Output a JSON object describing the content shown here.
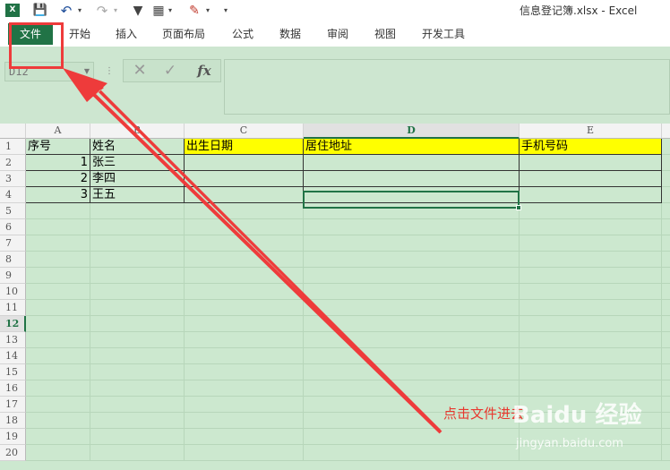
{
  "window": {
    "title": "信息登记簿.xlsx - Excel",
    "app_logo": "X"
  },
  "quick_access": {
    "icons": [
      "excel-logo-icon",
      "save-icon",
      "undo-icon",
      "redo-icon",
      "filter-icon",
      "form-icon",
      "clear-format-icon",
      "customize-icon"
    ]
  },
  "ribbon": {
    "tabs": [
      "文件",
      "开始",
      "插入",
      "页面布局",
      "公式",
      "数据",
      "审阅",
      "视图",
      "开发工具"
    ]
  },
  "formula_bar": {
    "name_box": "D12",
    "fx_label": "fx",
    "formula": ""
  },
  "sheet": {
    "columns": [
      "A",
      "B",
      "C",
      "D",
      "E"
    ],
    "selected_column": "D",
    "selected_row": "12",
    "rows": [
      "1",
      "2",
      "3",
      "4",
      "5",
      "6",
      "7",
      "8",
      "9",
      "10",
      "11",
      "12",
      "13",
      "14",
      "15",
      "16",
      "17",
      "18",
      "19",
      "20"
    ],
    "header_row": [
      "序号",
      "姓名",
      "出生日期",
      "居住地址",
      "手机号码"
    ],
    "data": [
      [
        "1",
        "张三",
        "",
        "",
        ""
      ],
      [
        "2",
        "李四",
        "",
        "",
        ""
      ],
      [
        "3",
        "王五",
        "",
        "",
        ""
      ]
    ],
    "header_fill": "#ffff00",
    "grid_tint": "#cce8cf"
  },
  "annotation": {
    "text": "点击文件进去",
    "color": "#ee3b3b"
  },
  "watermark": {
    "logo": "Baidu 经验",
    "url": "jingyan.baidu.com"
  }
}
